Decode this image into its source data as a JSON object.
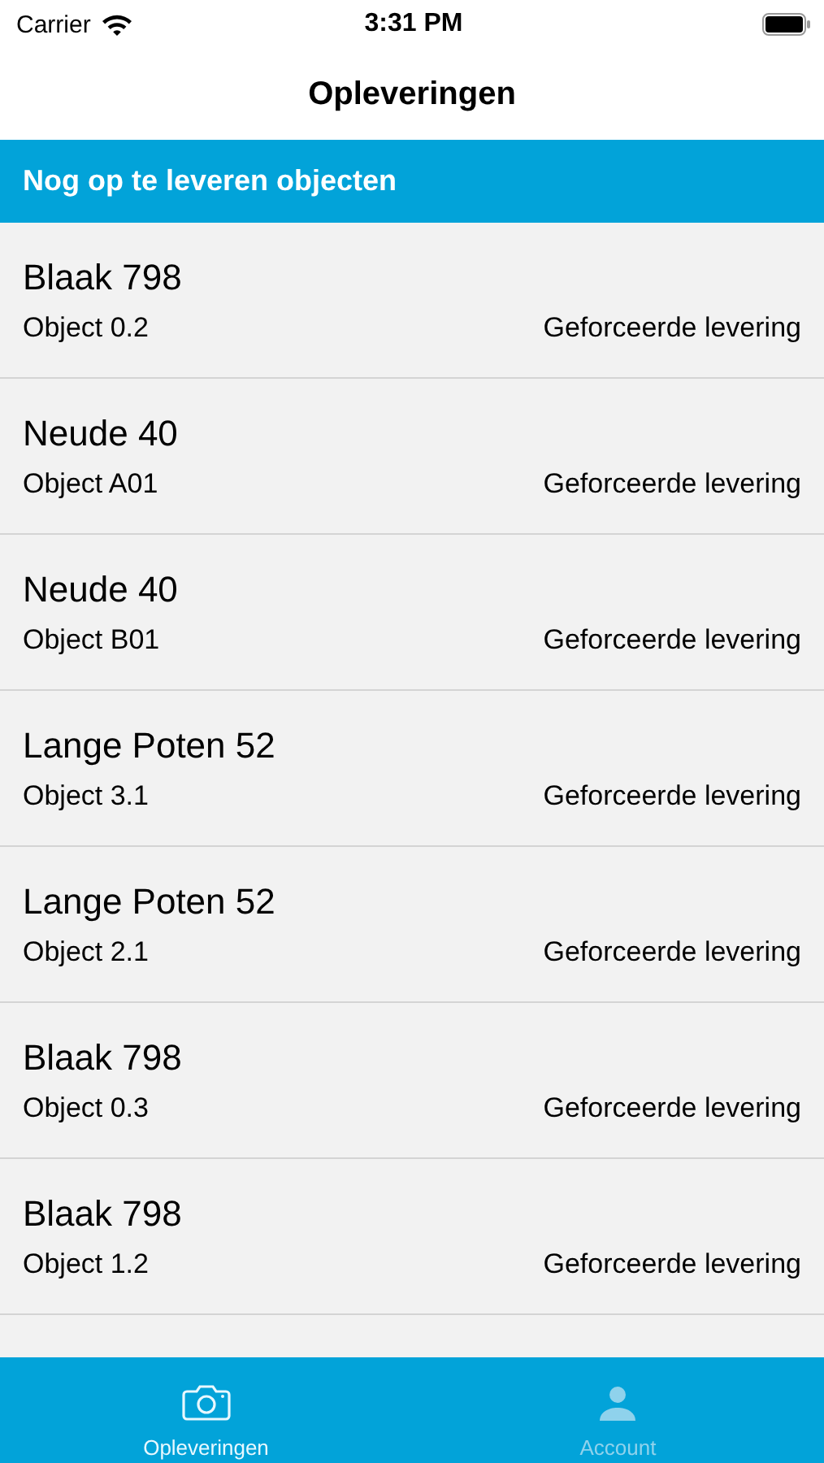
{
  "status_bar": {
    "carrier": "Carrier",
    "time": "3:31 PM"
  },
  "nav": {
    "title": "Opleveringen"
  },
  "section": {
    "title": "Nog op te leveren objecten"
  },
  "rows": [
    {
      "title": "Blaak 798",
      "subtitle": "Object 0.2",
      "status": "Geforceerde levering"
    },
    {
      "title": "Neude 40",
      "subtitle": "Object A01",
      "status": "Geforceerde levering"
    },
    {
      "title": "Neude 40",
      "subtitle": "Object B01",
      "status": "Geforceerde levering"
    },
    {
      "title": "Lange Poten 52",
      "subtitle": "Object 3.1",
      "status": "Geforceerde levering"
    },
    {
      "title": "Lange Poten 52",
      "subtitle": "Object 2.1",
      "status": "Geforceerde levering"
    },
    {
      "title": "Blaak 798",
      "subtitle": "Object 0.3",
      "status": "Geforceerde levering"
    },
    {
      "title": "Blaak 798",
      "subtitle": "Object 1.2",
      "status": "Geforceerde levering"
    }
  ],
  "tabs": [
    {
      "label": "Opleveringen",
      "kind": "camera",
      "selected": true
    },
    {
      "label": "Account",
      "kind": "person",
      "selected": false
    }
  ]
}
